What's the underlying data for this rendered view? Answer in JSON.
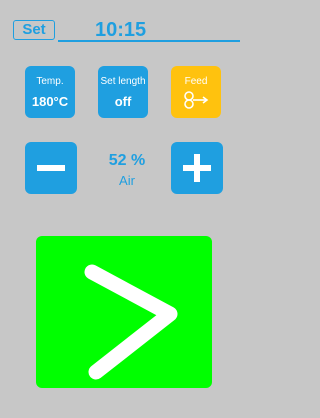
{
  "header": {
    "set_label": "Set",
    "time": "10:15"
  },
  "tiles": {
    "temp": {
      "label": "Temp.",
      "value": "180°C",
      "color": "#1f9fe0"
    },
    "set_length": {
      "label": "Set length",
      "value": "off",
      "color": "#1f9fe0"
    },
    "feed": {
      "label": "Feed",
      "icon": "feed-icon",
      "color": "#ffc20e"
    }
  },
  "air": {
    "percent": "52 %",
    "label": "Air",
    "minus_icon": "minus-icon",
    "plus_icon": "plus-icon"
  },
  "start": {
    "icon": "chevron-right-icon",
    "color": "#00ff00"
  },
  "colors": {
    "accent": "#1f9fe0",
    "background": "#c7c7c7",
    "feed": "#ffc20e",
    "start": "#00ff00"
  }
}
